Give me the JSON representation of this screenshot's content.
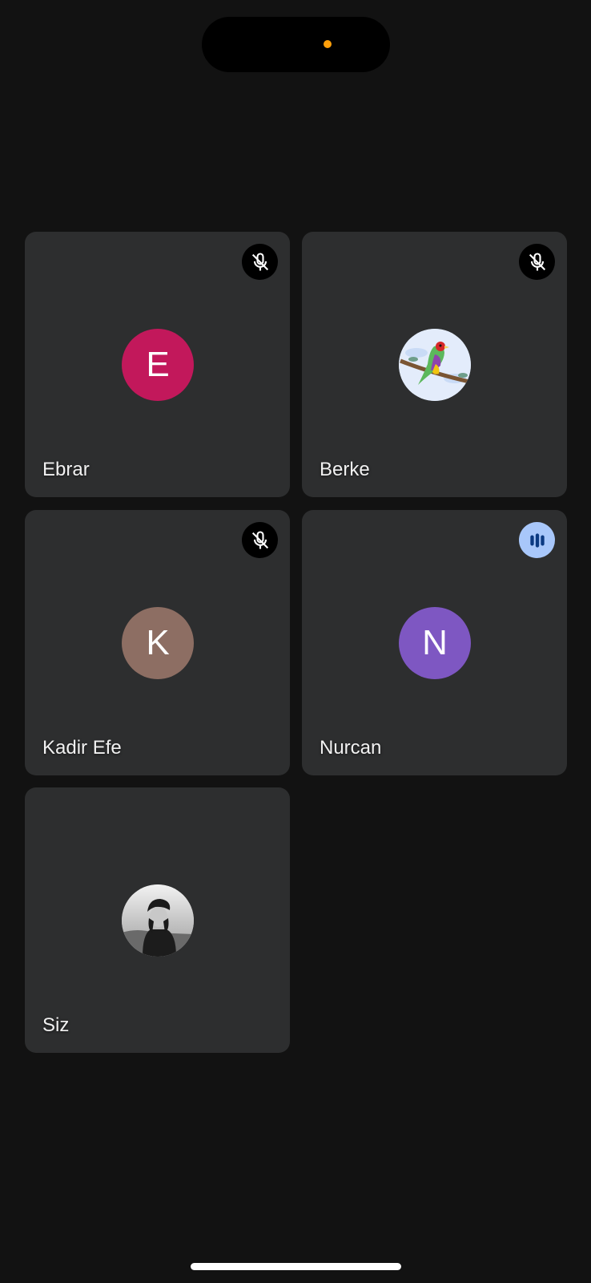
{
  "status_bar": {
    "privacy_indicator_color": "#ff9f0a"
  },
  "participants": [
    {
      "name": "Ebrar",
      "initial": "E",
      "avatar_type": "initial",
      "avatar_color": "#c2185b",
      "audio": "muted",
      "status_icon": "mic-off-icon"
    },
    {
      "name": "Berke",
      "initial": "",
      "avatar_type": "image",
      "avatar_image": "parrot-on-branch",
      "audio": "muted",
      "status_icon": "mic-off-icon"
    },
    {
      "name": "Kadir Efe",
      "initial": "K",
      "avatar_type": "initial",
      "avatar_color": "#8d6e63",
      "audio": "muted",
      "status_icon": "mic-off-icon"
    },
    {
      "name": "Nurcan",
      "initial": "N",
      "avatar_type": "initial",
      "avatar_color": "#7e57c2",
      "audio": "speaking",
      "status_icon": "audio-level-icon"
    },
    {
      "name": "Siz",
      "initial": "",
      "avatar_type": "image",
      "avatar_image": "user-photo-grayscale",
      "audio": "none",
      "status_icon": ""
    }
  ],
  "colors": {
    "background": "#121212",
    "tile": "#2d2e2f",
    "speaking_badge": "#a8c7fa",
    "speaking_bars": "#0b3a82"
  }
}
